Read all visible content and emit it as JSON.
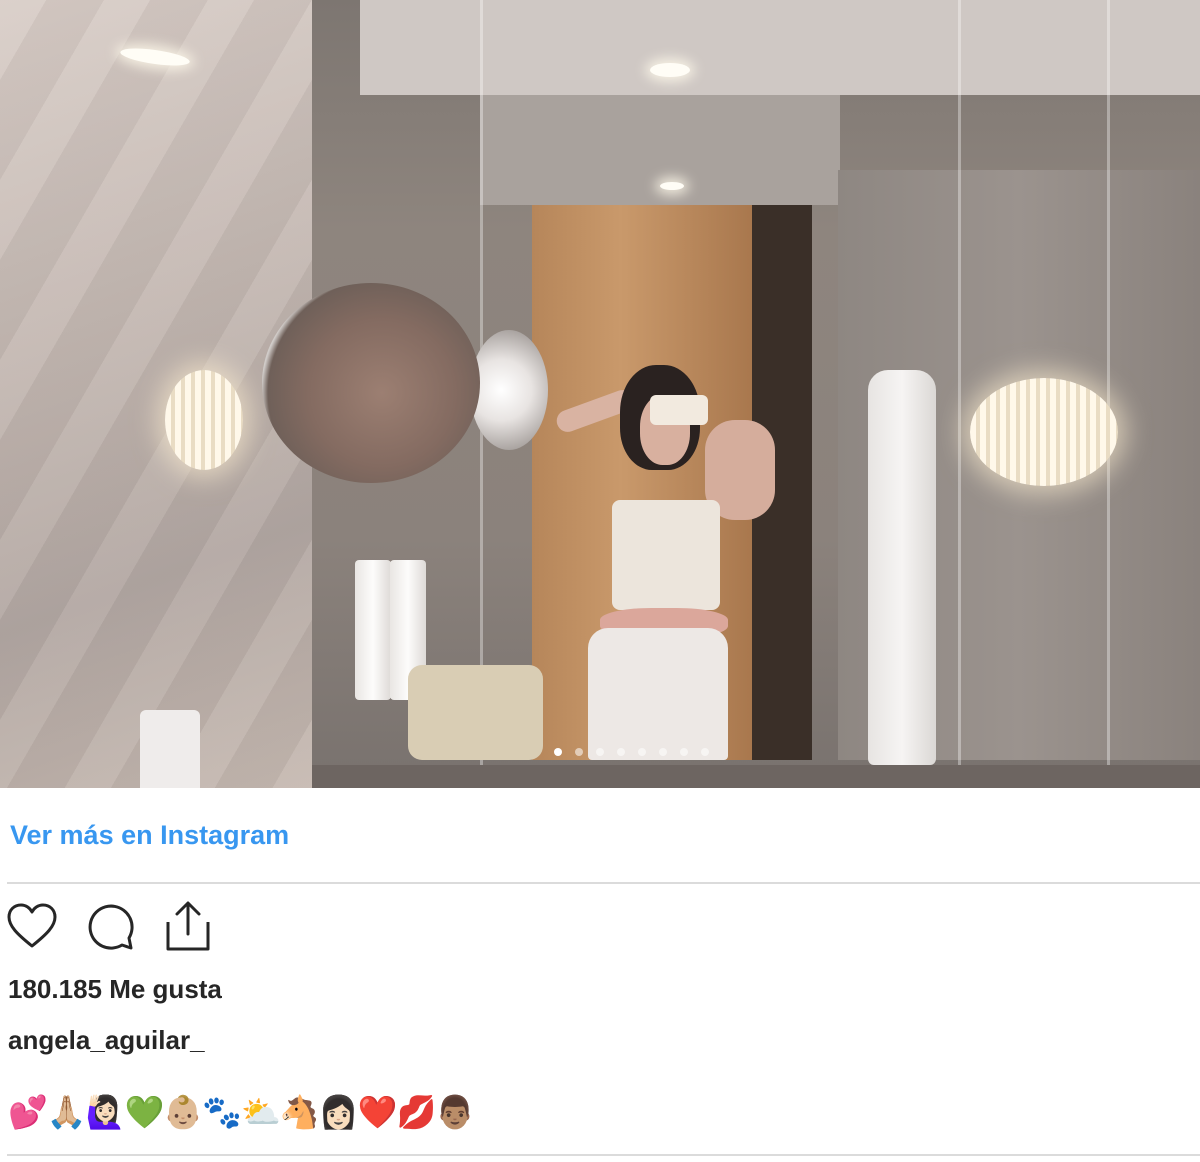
{
  "post": {
    "image_alt": "",
    "carousel": {
      "count": 8,
      "active_index": 0
    }
  },
  "view_more_link": "Ver más en Instagram",
  "actions": {
    "like_icon": "heart-icon",
    "comment_icon": "comment-icon",
    "share_icon": "share-icon"
  },
  "likes_text": "180.185 Me gusta",
  "username": "angela_aguilar_",
  "caption": "💕🙏🏼🙋🏻‍♀️💚👶🏼🐾⛅🐴👩🏻❤️💋👨🏽",
  "colors": {
    "link": "#3897f0",
    "text": "#262626",
    "divider": "#dbdbdb"
  }
}
